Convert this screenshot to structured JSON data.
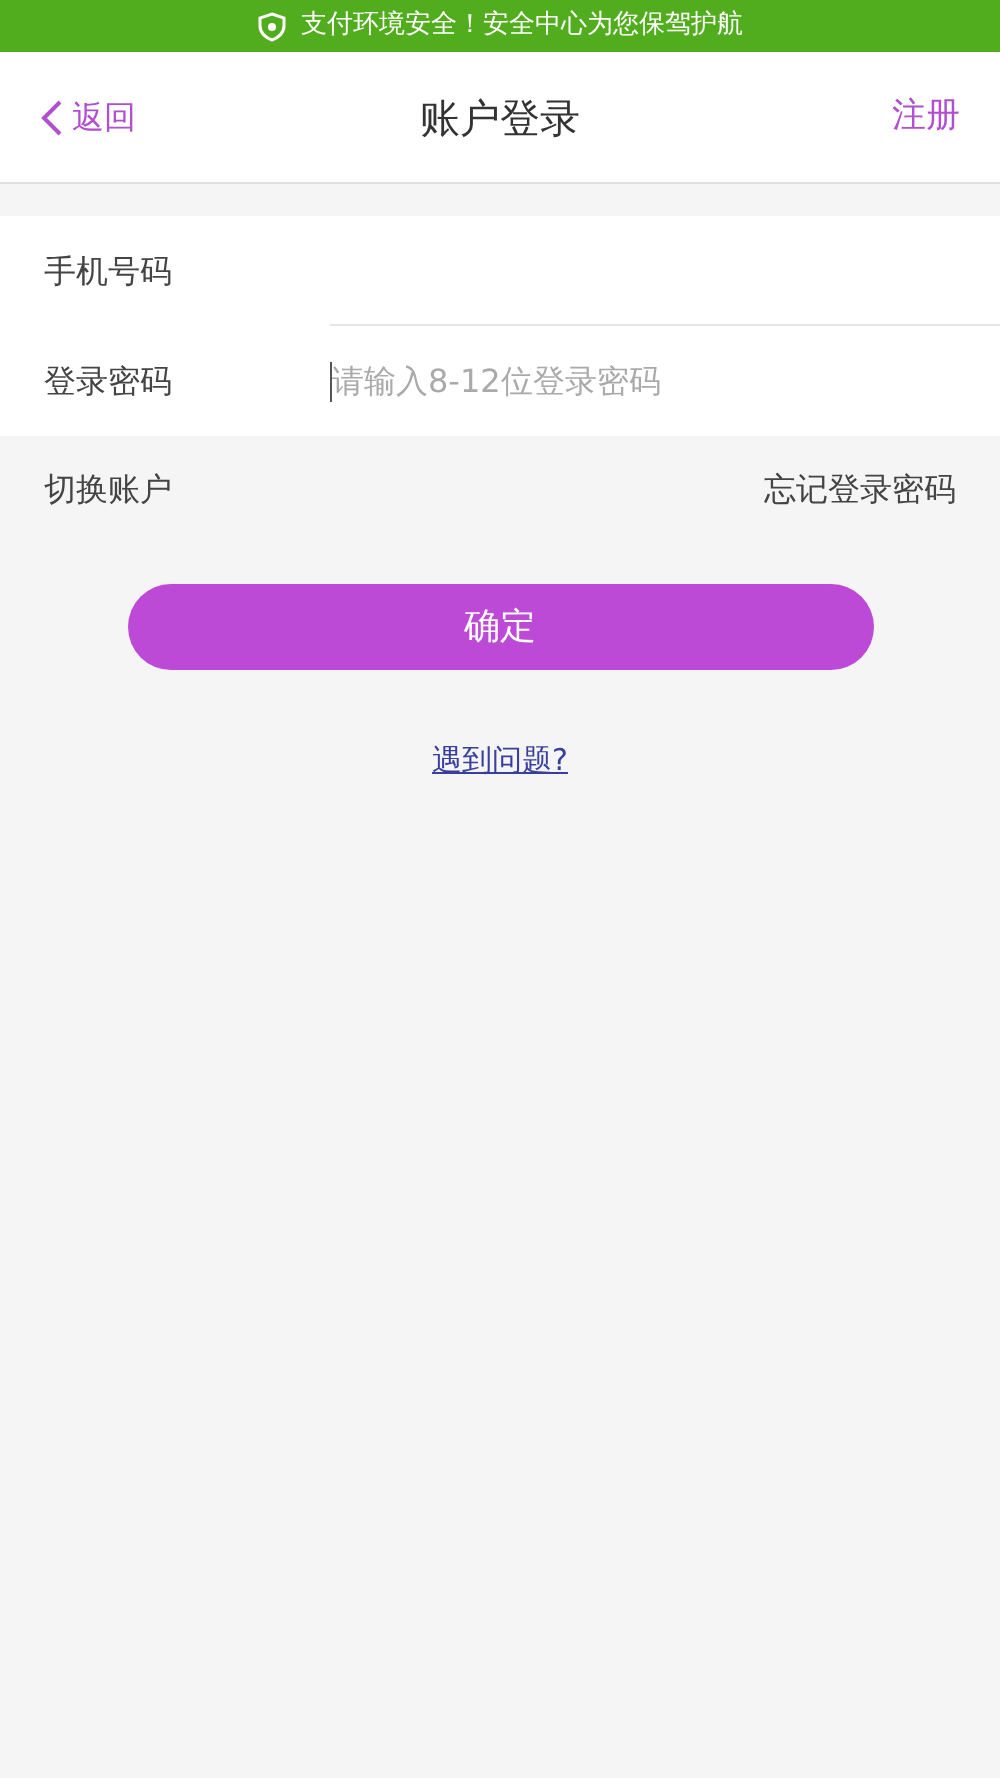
{
  "banner": {
    "text": "支付环境安全！安全中心为您保驾护航"
  },
  "nav": {
    "back": "返回",
    "title": "账户登录",
    "action": "注册"
  },
  "fields": [
    {
      "label": "手机号码",
      "focused": false
    },
    {
      "label": "登录密码",
      "placeholder": "请输入8-12位登录密码",
      "focused": true
    }
  ],
  "links": {
    "switch": "切换账户",
    "forgot": "忘记登录密码"
  },
  "submit": "确定",
  "help": "遇到问题?"
}
